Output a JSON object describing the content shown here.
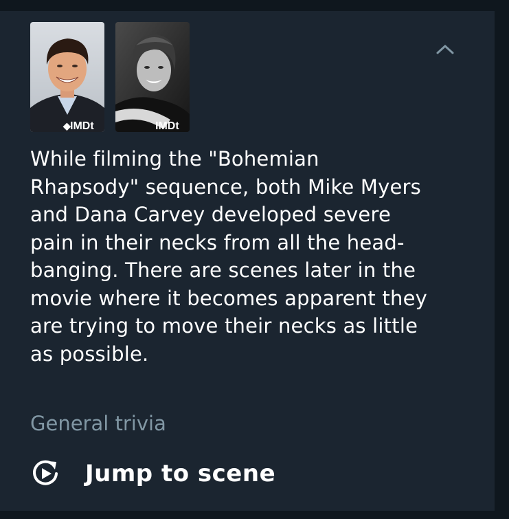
{
  "trivia": {
    "text": "While filming the \"Bohemian Rhapsody\" sequence, both Mike Myers and Dana Carvey developed severe pain in their necks from all the head-banging. There are scenes later in the movie where it becomes apparent they are trying to move their necks as little as possible.",
    "category": "General trivia"
  },
  "photos": [
    {
      "watermark": "IMDt"
    },
    {
      "watermark": "IMDt"
    }
  ],
  "actions": {
    "jump_label": "Jump to scene"
  },
  "icons": {
    "collapse": "chevron-up-icon",
    "jump": "replay-icon"
  },
  "colors": {
    "background": "#0f171e",
    "card": "#1b2530",
    "text": "#ffffff",
    "muted": "#8197a4"
  }
}
